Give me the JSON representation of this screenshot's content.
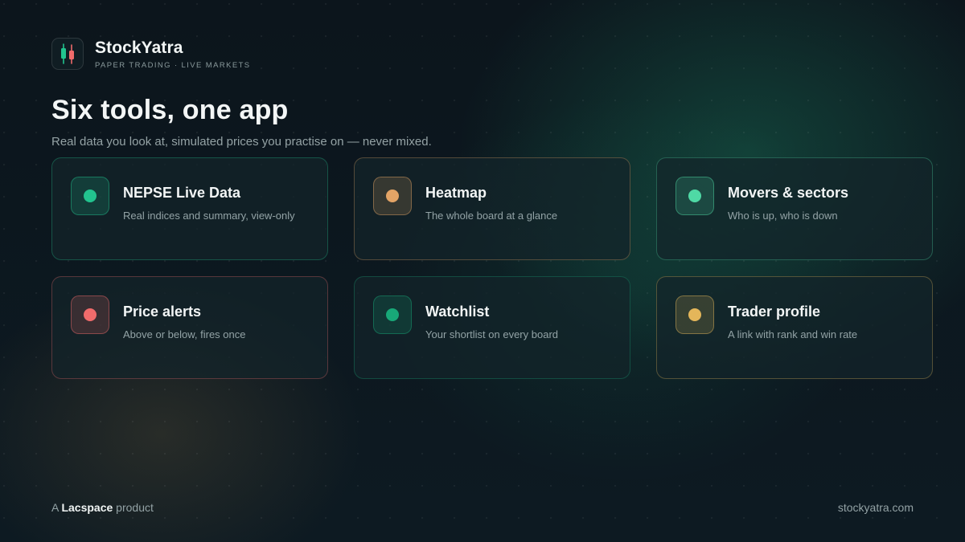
{
  "brand": {
    "name": "StockYatra",
    "tagline": "PAPER TRADING · LIVE MARKETS",
    "logo_icon": "candlestick-icon",
    "logo_colors": [
      "#22c38e",
      "#f06b6b"
    ]
  },
  "hero": {
    "title": "Six tools, one app",
    "subtitle": "Real data you look at, simulated prices you practise on — never mixed."
  },
  "tools": [
    {
      "title": "NEPSE Live Data",
      "desc": "Real indices and summary, view-only",
      "accent": "#22c38e"
    },
    {
      "title": "Heatmap",
      "desc": "The whole board at a glance",
      "accent": "#e3a466"
    },
    {
      "title": "Movers & sectors",
      "desc": "Who is up, who is down",
      "accent": "#4fd9a5"
    },
    {
      "title": "Price alerts",
      "desc": "Above or below, fires once",
      "accent": "#f06b6b"
    },
    {
      "title": "Watchlist",
      "desc": "Your shortlist on every board",
      "accent": "#18a878"
    },
    {
      "title": "Trader profile",
      "desc": "A link with rank and win rate",
      "accent": "#e4b65a"
    }
  ],
  "footer": {
    "left_prefix": "A ",
    "left_brand": "Lacspace",
    "left_suffix": " product",
    "right": "stockyatra.com"
  }
}
